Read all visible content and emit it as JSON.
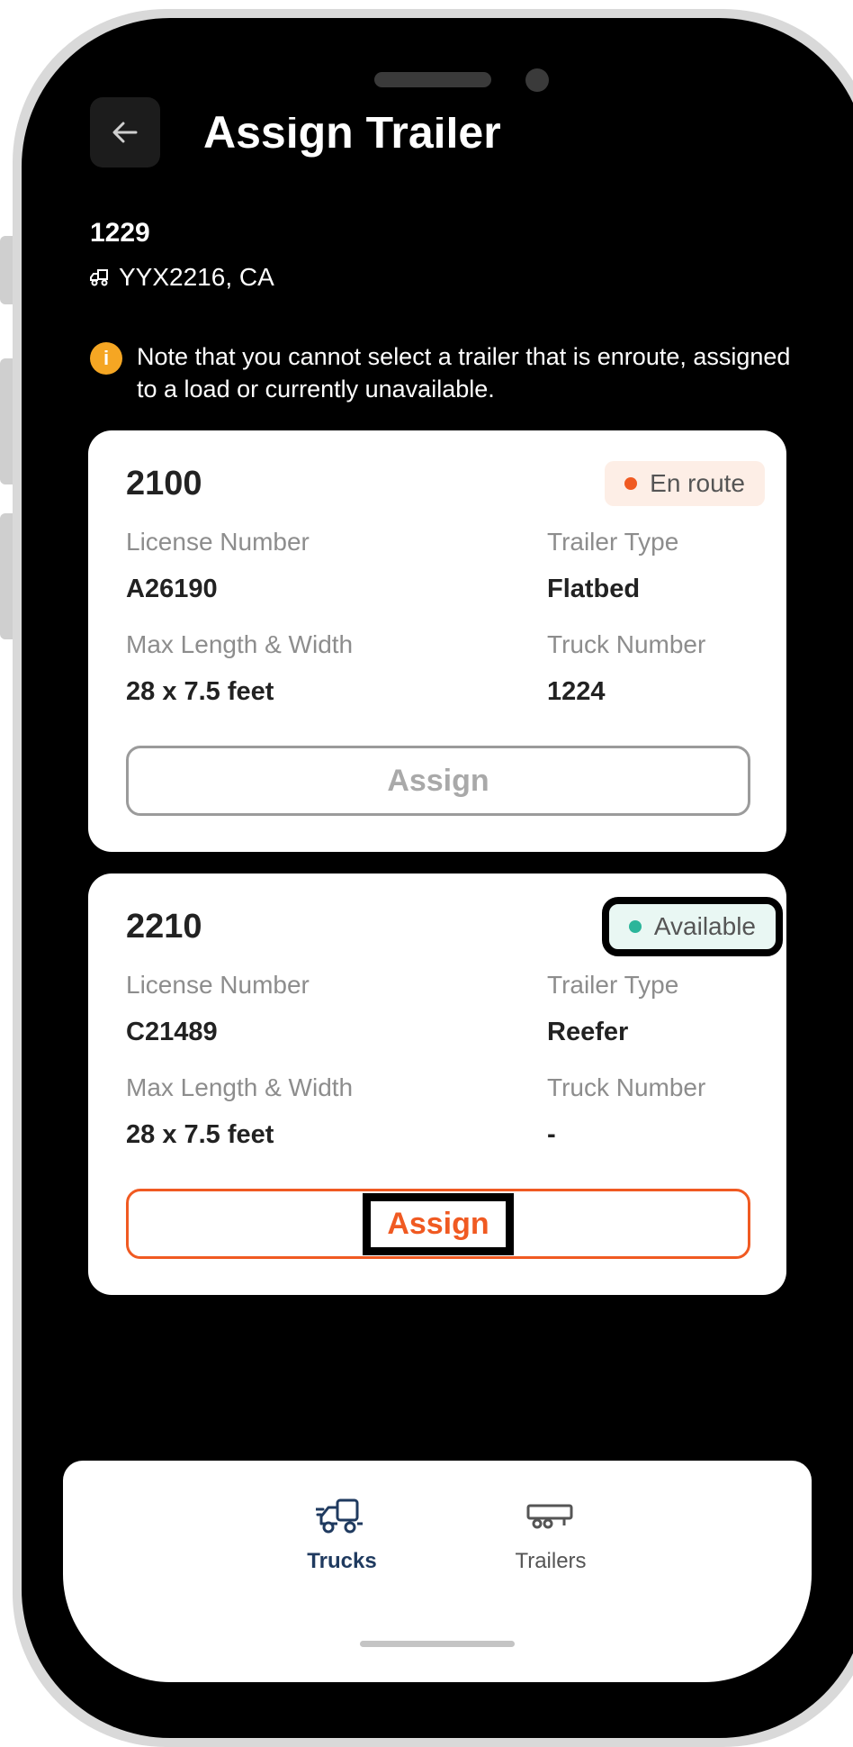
{
  "header": {
    "title": "Assign Trailer"
  },
  "truck": {
    "number": "1229",
    "plate": "YYX2216, CA"
  },
  "note": {
    "text": "Note that you cannot select a trailer that is enroute, assigned to a load or currently unavailable."
  },
  "labels": {
    "license": "License Number",
    "trailer_type": "Trailer Type",
    "dimensions": "Max Length & Width",
    "truck_number": "Truck Number",
    "assign": "Assign"
  },
  "trailers": [
    {
      "id": "2100",
      "status": "En route",
      "license": "A26190",
      "trailer_type": "Flatbed",
      "dimensions": "28 x 7.5 feet",
      "truck_number": "1224"
    },
    {
      "id": "2210",
      "status": "Available",
      "license": "C21489",
      "trailer_type": "Reefer",
      "dimensions": "28 x 7.5 feet",
      "truck_number": "-"
    }
  ],
  "tabs": {
    "trucks": "Trucks",
    "trailers": "Trailers"
  },
  "colors": {
    "accent": "#f05a22",
    "enroute": "#f05a22",
    "available": "#2bb59a",
    "tab_active": "#1f3a5f"
  }
}
